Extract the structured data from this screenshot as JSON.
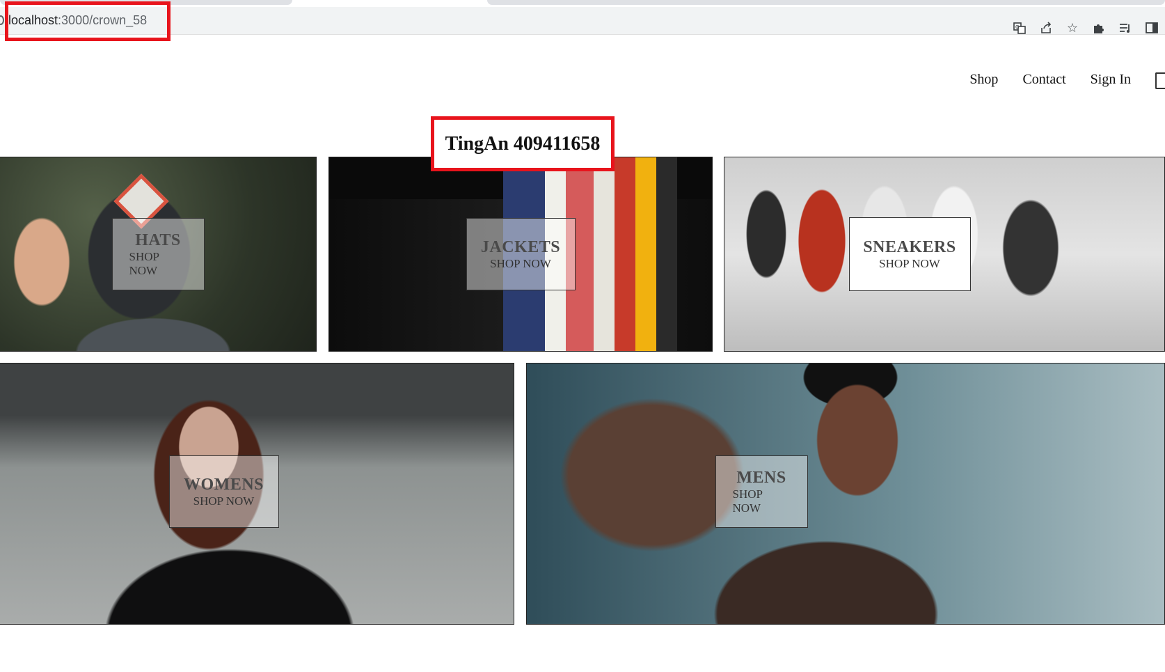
{
  "browser": {
    "url_host": "localhost",
    "url_rest": ":3000/crown_58",
    "icons": [
      "translate-icon",
      "share-icon",
      "star-icon",
      "extensions-icon",
      "reading-list-icon",
      "side-panel-icon"
    ]
  },
  "nav": {
    "shop": "Shop",
    "contact": "Contact",
    "sign_in": "Sign In"
  },
  "title": "TingAn 409411658",
  "categories": [
    {
      "title": "HATS",
      "subtitle": "SHOP NOW"
    },
    {
      "title": "JACKETS",
      "subtitle": "SHOP NOW"
    },
    {
      "title": "SNEAKERS",
      "subtitle": "SHOP NOW"
    },
    {
      "title": "WOMENS",
      "subtitle": "SHOP NOW"
    },
    {
      "title": "MENS",
      "subtitle": "SHOP NOW"
    }
  ],
  "colors": {
    "highlight": "#e8141c",
    "text": "#111111"
  }
}
